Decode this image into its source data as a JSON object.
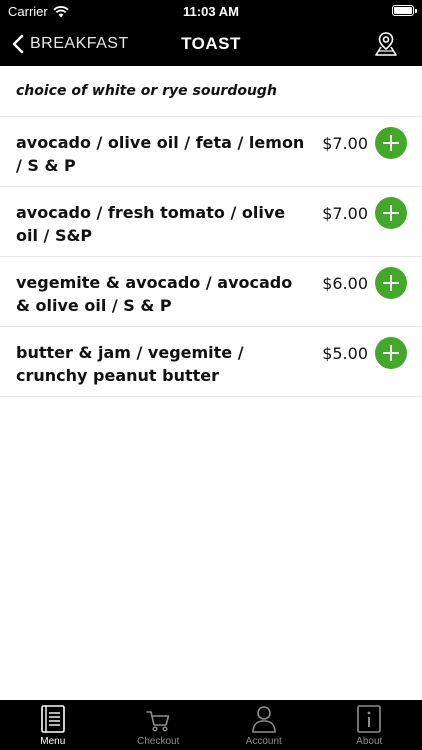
{
  "status_bar": {
    "carrier": "Carrier",
    "time": "11:03 AM"
  },
  "nav": {
    "back_label": "BREAKFAST",
    "title": "TOAST",
    "map_icon": "map-pin-icon"
  },
  "description": "choice of white or rye sourdough",
  "items": [
    {
      "name": "avocado / olive oil / feta / lemon / S & P",
      "price": "$7.00"
    },
    {
      "name": "avocado / fresh tomato / olive oil / S&P",
      "price": "$7.00"
    },
    {
      "name": "vegemite & avocado / avocado & olive oil / S & P",
      "price": "$6.00"
    },
    {
      "name": "butter & jam / vegemite / crunchy peanut butter",
      "price": "$5.00"
    }
  ],
  "tabs": [
    {
      "label": "Menu",
      "icon": "menu-book-icon",
      "active": true
    },
    {
      "label": "Checkout",
      "icon": "cart-icon",
      "active": false
    },
    {
      "label": "Account",
      "icon": "person-icon",
      "active": false
    },
    {
      "label": "About",
      "icon": "info-icon",
      "active": false
    }
  ],
  "colors": {
    "accent_green": "#43a72a",
    "bar_black": "#000000"
  }
}
